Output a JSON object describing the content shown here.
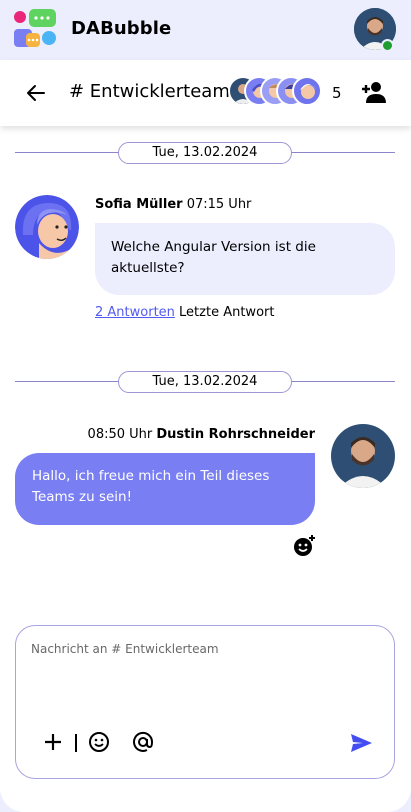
{
  "app": {
    "name": "DABubble"
  },
  "colors": {
    "accent": "#797ef3",
    "accent_dark": "#444df2",
    "online": "#1e9e2e",
    "background": "#eceefe"
  },
  "channel": {
    "name": "# Entwicklerteam",
    "member_count": "5",
    "member_icons": [
      "avatar-dustin",
      "avatar-1",
      "avatar-2",
      "avatar-3",
      "avatar-4"
    ]
  },
  "thread": [
    {
      "date": "Tue, 13.02.2024",
      "sender": "Sofia Müller",
      "time": "07:15 Uhr",
      "text": "Welche Angular Version ist die aktuellste?",
      "replies_link": "2 Antworten",
      "replies_text": "Letzte Antwort"
    },
    {
      "date": "Tue, 13.02.2024",
      "sender": "Dustin Rohrschneider",
      "time": "08:50 Uhr",
      "text": "Hallo, ich freue mich ein Teil dieses Teams zu sein!"
    }
  ],
  "composer": {
    "placeholder": "Nachricht an # Entwicklerteam",
    "tools": [
      "plus-icon",
      "smiley-icon",
      "at-icon"
    ],
    "send_icon": "send-icon"
  }
}
